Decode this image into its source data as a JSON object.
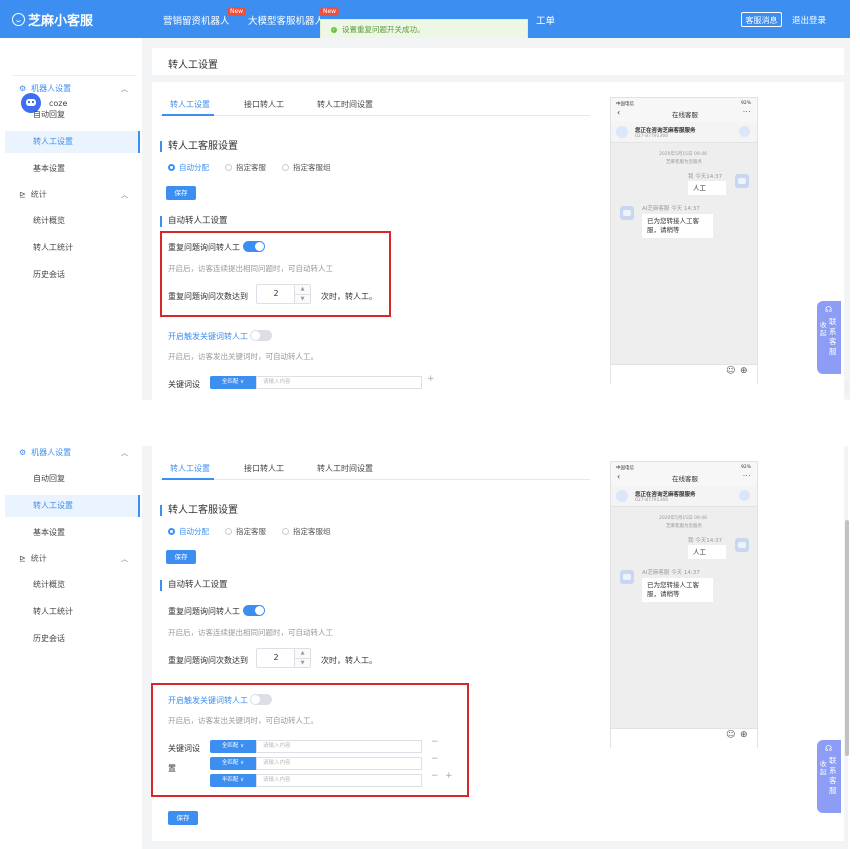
{
  "topbar": {
    "logo": "芝麻小客服",
    "nav": [
      {
        "label": "营销留资机器人",
        "badge": "New"
      },
      {
        "label": "大模型客服机器人",
        "badge": "New"
      },
      {
        "label": "工单"
      }
    ],
    "customer_service_btn": "客服消息",
    "logout": "退出登录"
  },
  "toast": {
    "message": "设置重复问题开关成功。"
  },
  "user": {
    "name": "coze"
  },
  "sidebar": {
    "groups": [
      {
        "label": "机器人设置",
        "items": [
          "自动回复",
          "转人工设置",
          "基本设置"
        ]
      },
      {
        "label": "统计",
        "items": [
          "统计概览",
          "转人工统计",
          "历史会话"
        ]
      }
    ],
    "active": "转人工设置"
  },
  "page": {
    "title": "转人工设置"
  },
  "tabs": [
    "转人工设置",
    "接口转人工",
    "转人工时间设置"
  ],
  "settings": {
    "cs_title": "转人工客服设置",
    "radio_options": [
      "自动分配",
      "指定客服",
      "指定客服组"
    ],
    "save": "保存",
    "auto_title": "自动转人工设置",
    "repeat_label": "重复问题询问转人工",
    "repeat_hint": "开启后，访客连续提出相同问题时，可自动转人工",
    "repeat_count_label": "重复问题询问次数达到",
    "repeat_count_value": "2",
    "repeat_count_suffix": "次时，转人工。",
    "keyword_label": "开启触发关键词转人工",
    "keyword_hint": "开启后，访客发出关键词时，可自动转人工。",
    "keyword_set_label_1": "关键词设",
    "keyword_set_label_2": "置",
    "keyword_set_label_full": "关键词设",
    "match_options": [
      "全匹配 ∨",
      "全匹配 ∨",
      "半匹配 ∨"
    ],
    "match_first": "全匹配 ∨",
    "keyword_placeholder": "请输入内容"
  },
  "phone": {
    "carrier": "中国电信",
    "battery": "92%",
    "title": "在线客服",
    "service_name": "您正在咨询芝麻客服服务",
    "service_phone": "027-87791366",
    "timestamp": "2020年5月15日 09:46",
    "timestamp_sub": "芝麻客服为您服务",
    "user_meta": "我 今天14:37",
    "user_msg": "人工",
    "bot_meta": "AI芝麻客服 今天 14:37",
    "bot_msg_1": "已为您转接人工客",
    "bot_msg_2": "服，请稍等"
  },
  "float": {
    "collapse": "收起",
    "contact": "联系客服"
  }
}
